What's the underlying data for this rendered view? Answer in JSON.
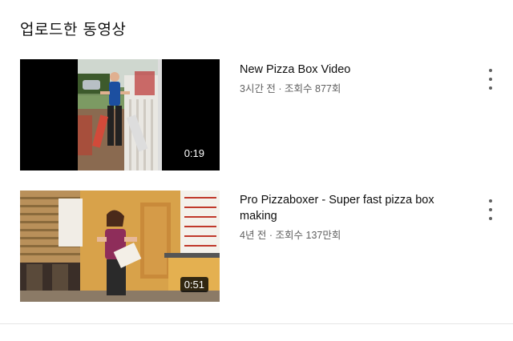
{
  "section": {
    "title": "업로드한 동영상"
  },
  "videos": [
    {
      "title": "New Pizza Box Video",
      "meta": "3시간 전 · 조회수 877회",
      "duration": "0:19"
    },
    {
      "title": "Pro Pizzaboxer - Super fast pizza box making",
      "meta": "4년 전 · 조회수 137만회",
      "duration": "0:51"
    }
  ]
}
